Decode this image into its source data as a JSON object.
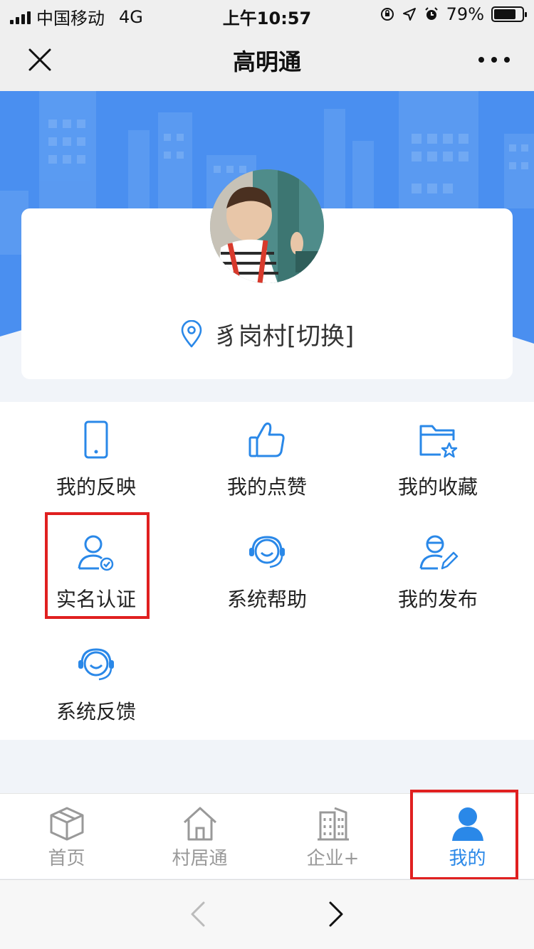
{
  "status_bar": {
    "carrier": "中国移动",
    "network": "4G",
    "time": "上午10:57",
    "battery": "79%",
    "battery_level": 0.79
  },
  "navbar": {
    "title": "高明通"
  },
  "profile": {
    "location": "豸岗村[切换]"
  },
  "menu": {
    "items": [
      {
        "label": "我的反映",
        "icon": "phone-icon"
      },
      {
        "label": "我的点赞",
        "icon": "thumbs-up-icon"
      },
      {
        "label": "我的收藏",
        "icon": "folder-star-icon"
      },
      {
        "label": "实名认证",
        "icon": "user-verified-icon"
      },
      {
        "label": "系统帮助",
        "icon": "headset-icon"
      },
      {
        "label": "我的发布",
        "icon": "user-edit-icon"
      },
      {
        "label": "系统反馈",
        "icon": "headset-icon"
      }
    ]
  },
  "tabbar": {
    "tabs": [
      {
        "label": "首页",
        "icon": "box-icon"
      },
      {
        "label": "村居通",
        "icon": "house-icon"
      },
      {
        "label": "企业+",
        "icon": "building-icon"
      },
      {
        "label": "我的",
        "icon": "person-icon",
        "active": true
      }
    ]
  },
  "colors": {
    "accent": "#2a88e8",
    "hero_blue": "#4a8ff0",
    "highlight": "#e02020"
  }
}
